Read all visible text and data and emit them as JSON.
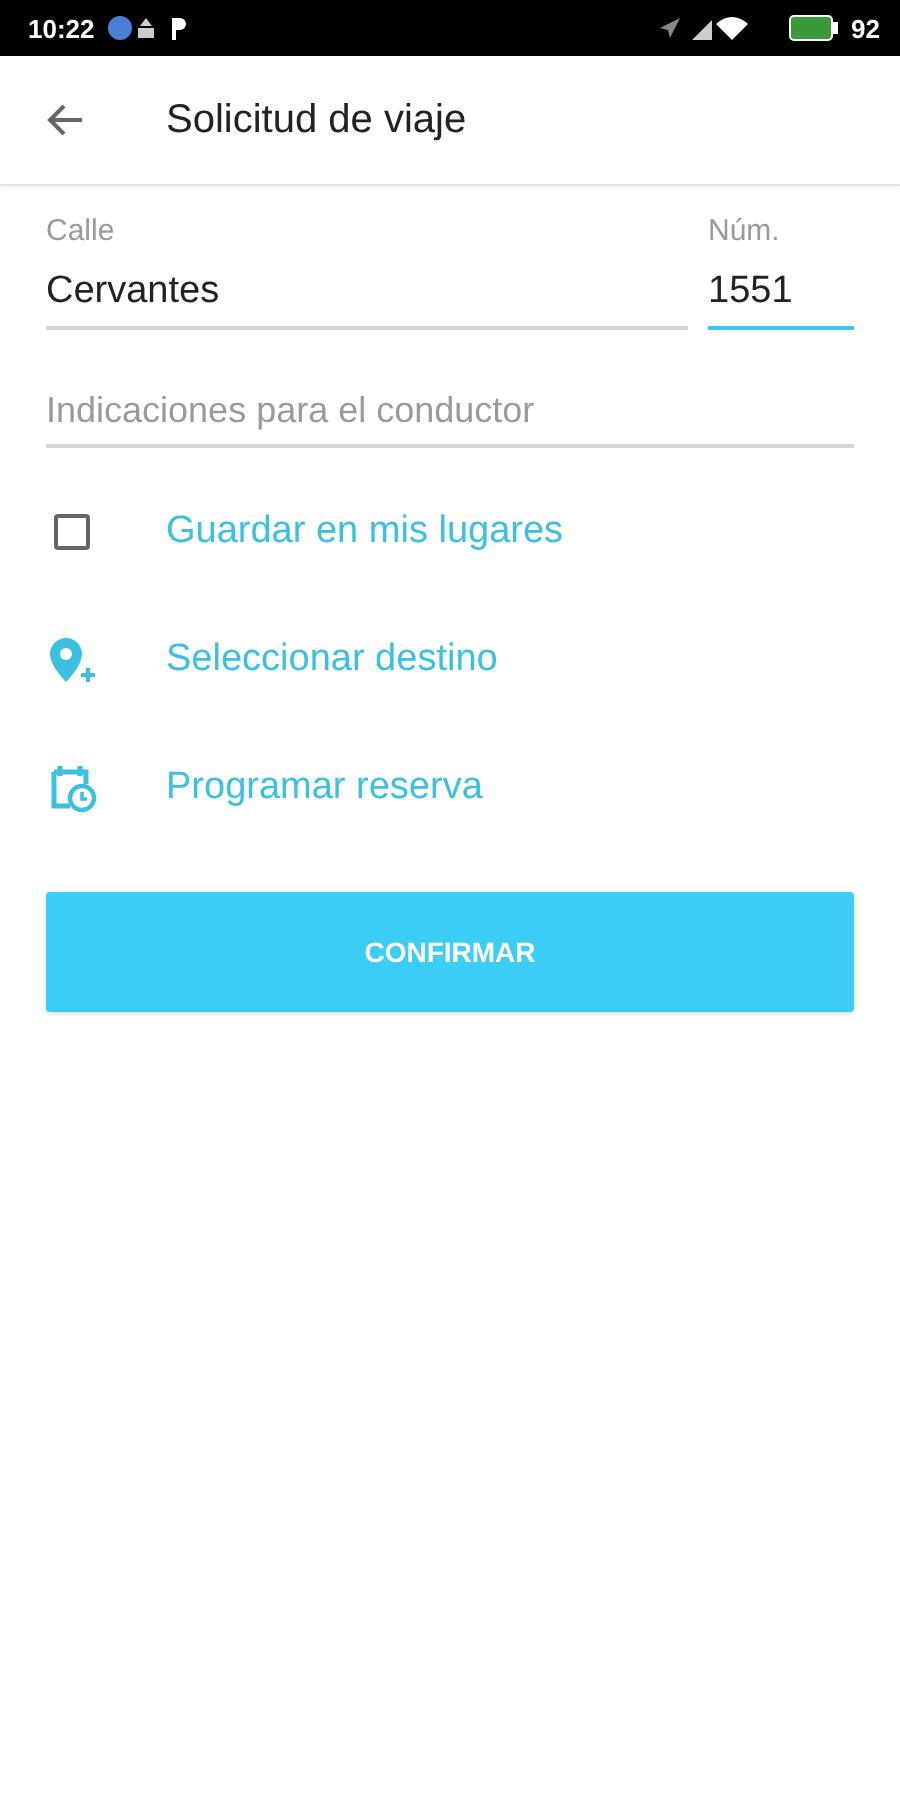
{
  "status_bar": {
    "time": "10:22",
    "battery": "92"
  },
  "header": {
    "title": "Solicitud de viaje"
  },
  "street": {
    "label": "Calle",
    "value": "Cervantes",
    "focused": false
  },
  "number": {
    "label": "Núm.",
    "value": "1551",
    "focused": true
  },
  "notes": {
    "placeholder": "Indicaciones para el conductor"
  },
  "actions": [
    {
      "kind": "checkbox",
      "label": "Guardar en mis lugares",
      "checked": false
    },
    {
      "kind": "destination",
      "label": "Seleccionar destino"
    },
    {
      "kind": "schedule",
      "label": "Programar reserva"
    }
  ],
  "confirm_button": "CONFIRMAR"
}
